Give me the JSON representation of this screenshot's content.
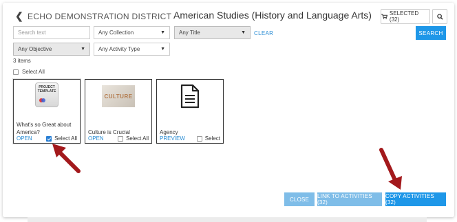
{
  "header": {
    "back_label": "ECHO DEMONSTRATION DISTRICT",
    "title": "American Studies (History and Language Arts)",
    "selected_label": "SELECTED (32)"
  },
  "filters": {
    "search_placeholder": "Search text",
    "collection": "Any Collection",
    "title_filter": "Any Title",
    "objective": "Any Objective",
    "activity_type": "Any Activity Type",
    "clear_label": "CLEAR",
    "search_button": "SEARCH"
  },
  "results": {
    "count": "3 items",
    "select_all": "Select All",
    "cards": [
      {
        "name": "What's so Great about America?",
        "action": "OPEN",
        "select_label": "Select All",
        "checked": true,
        "thumb_text": "PROJECT TEMPLATE"
      },
      {
        "name": "Culture is Crucial",
        "action": "OPEN",
        "select_label": "Select All",
        "checked": false,
        "thumb_text": "CULTURE"
      },
      {
        "name": "Agency",
        "action": "PREVIEW",
        "select_label": "Select",
        "checked": false
      }
    ]
  },
  "footer": {
    "close": "CLOSE",
    "link": "LINK TO ACTIVITIES (32)",
    "copy": "COPY ACTIVITIES (32)"
  },
  "colors": {
    "primary": "#1e97e8",
    "primary_light": "#7fbde8",
    "link": "#2a8dd4",
    "arrow": "#a3191c"
  }
}
